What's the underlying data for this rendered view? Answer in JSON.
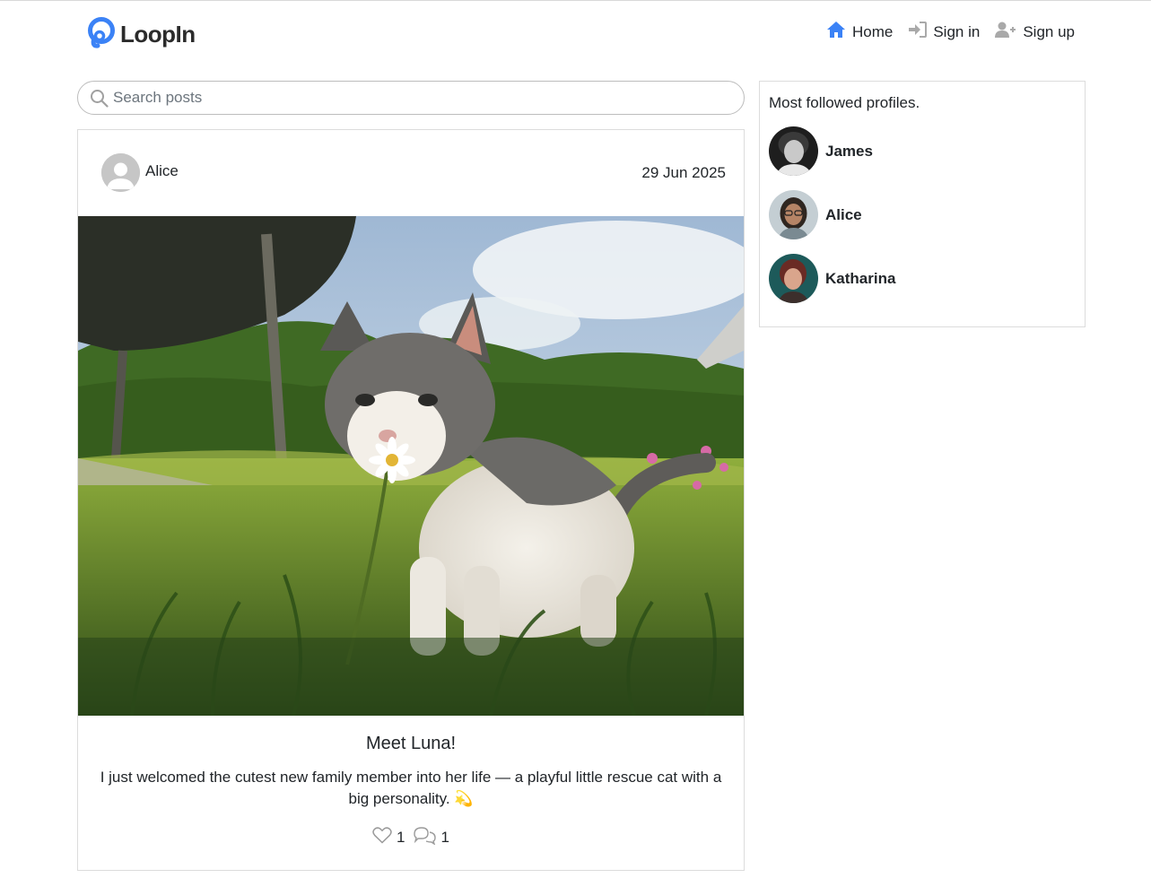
{
  "brand": {
    "name": "LoopIn"
  },
  "nav": {
    "home": "Home",
    "sign_in": "Sign in",
    "sign_up": "Sign up"
  },
  "search": {
    "placeholder": "Search posts",
    "value": ""
  },
  "post": {
    "author": "Alice",
    "date": "29 Jun 2025",
    "title": "Meet Luna!",
    "body": "I just welcomed the cutest new family member into her life — a playful little rescue cat with a big personality. 💫",
    "likes": "1",
    "comments": "1"
  },
  "sidebar": {
    "title": "Most followed profiles.",
    "profiles": [
      {
        "name": "James"
      },
      {
        "name": "Alice"
      },
      {
        "name": "Katharina"
      }
    ]
  },
  "colors": {
    "accent": "#3b82f6",
    "icon_gray": "#a9a9a9",
    "border": "#dcdcdc"
  }
}
